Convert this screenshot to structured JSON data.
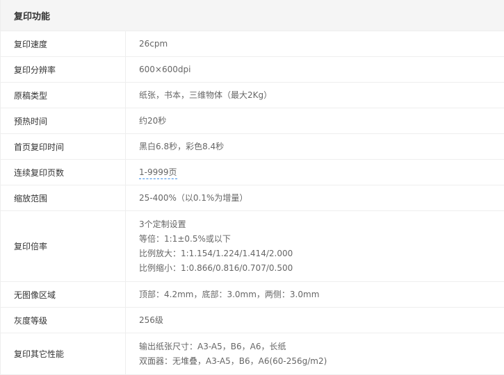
{
  "section": {
    "title": "复印功能"
  },
  "rows": [
    {
      "label": "复印速度",
      "values": [
        "26cpm"
      ]
    },
    {
      "label": "复印分辨率",
      "values": [
        "600×600dpi"
      ]
    },
    {
      "label": "原稿类型",
      "values": [
        "纸张，书本，三维物体（最大2Kg）"
      ]
    },
    {
      "label": "预热时间",
      "values": [
        "约20秒"
      ]
    },
    {
      "label": "首页复印时间",
      "values": [
        "黑白6.8秒，彩色8.4秒"
      ]
    },
    {
      "label": "连续复印页数",
      "values": [
        "1-9999页"
      ]
    },
    {
      "label": "缩放范围",
      "values": [
        "25-400%（以0.1%为增量）"
      ]
    },
    {
      "label": "复印倍率",
      "values": [
        "3个定制设置",
        "等倍：1:1±0.5%或以下",
        "比例放大：1:1.154/1.224/1.414/2.000",
        "比例缩小：1:0.866/0.816/0.707/0.500"
      ]
    },
    {
      "label": "无图像区域",
      "values": [
        "顶部：4.2mm，底部：3.0mm，两侧：3.0mm"
      ]
    },
    {
      "label": "灰度等级",
      "values": [
        "256级"
      ]
    },
    {
      "label": "复印其它性能",
      "values": [
        "输出纸张尺寸：A3-A5，B6，A6，长纸",
        "双面器：无堆叠，A3-A5，B6，A6(60-256g/m2)"
      ]
    }
  ]
}
